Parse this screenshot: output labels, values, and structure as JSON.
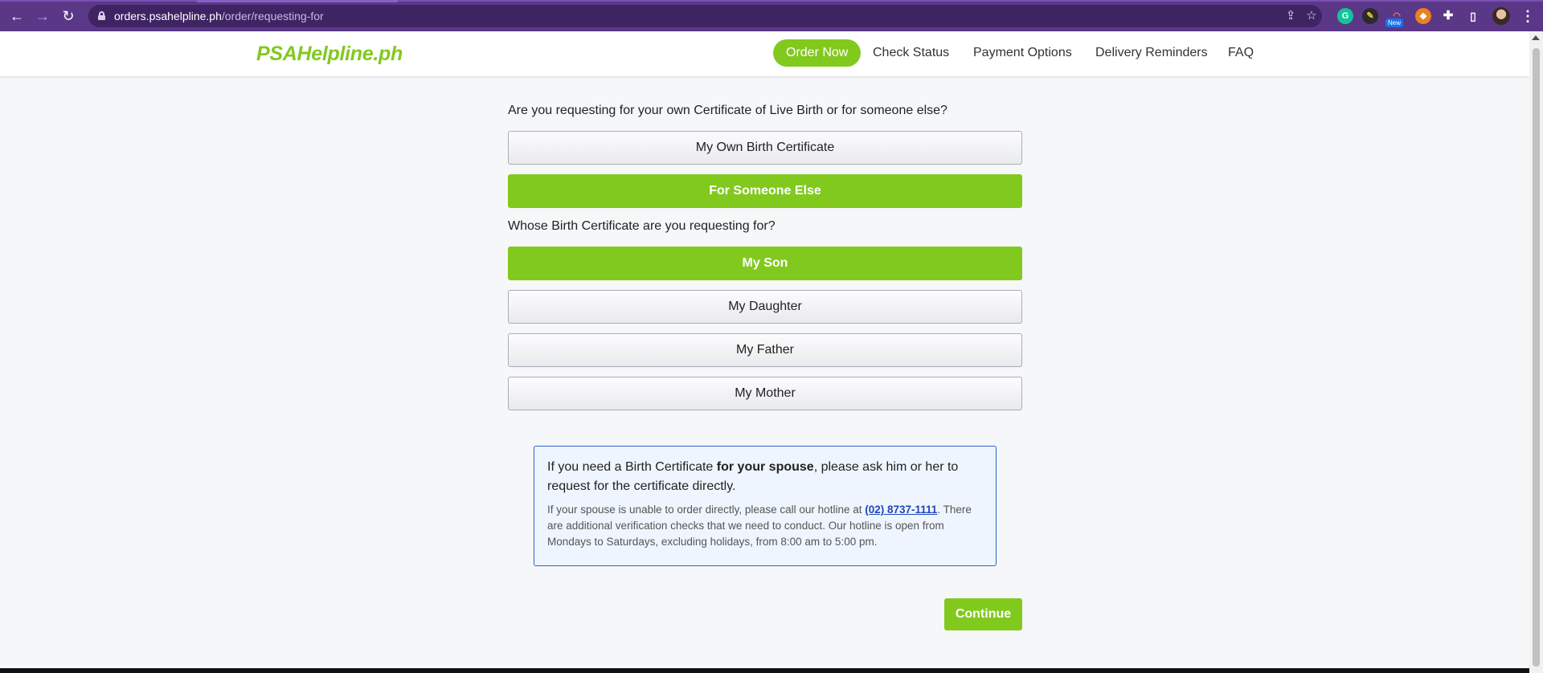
{
  "browser": {
    "url_host": "orders.psahelpline.ph",
    "url_path": "/order/requesting-for",
    "new_badge": "New",
    "icons": [
      "back-arrow-icon",
      "forward-arrow-icon",
      "reload-icon",
      "lock-icon",
      "share-icon",
      "bookmark-star-icon",
      "grammarly-icon",
      "extension-icon",
      "rainbow-extension-icon",
      "fox-extension-icon",
      "puzzle-icon",
      "side-panel-icon",
      "profile-avatar",
      "kebab-menu-icon"
    ]
  },
  "header": {
    "logo": "PSAHelpline.ph",
    "nav": [
      "Order Now",
      "Check Status",
      "Payment Options",
      "Delivery Reminders",
      "FAQ"
    ],
    "active_nav": "Order Now"
  },
  "form": {
    "question1": "Are you requesting for your own Certificate of Live Birth or for someone else?",
    "q1_options": [
      "My Own Birth Certificate",
      "For Someone Else"
    ],
    "q1_selected": "For Someone Else",
    "question2": "Whose Birth Certificate are you requesting for?",
    "q2_options": [
      "My Son",
      "My Daughter",
      "My Father",
      "My Mother"
    ],
    "q2_selected": "My Son"
  },
  "notice": {
    "main_prefix": "If you need a Birth Certificate ",
    "main_bold": "for your spouse",
    "main_suffix": ", please ask him or her to request for the certificate directly.",
    "sub_prefix": "If your spouse is unable to order directly, please call our hotline at ",
    "hotline": "(02) 8737-1111",
    "sub_suffix": ". There are additional verification checks that we need to conduct. Our hotline is open from Mondays to Saturdays, excluding holidays, from 8:00 am to 5:00 pm."
  },
  "actions": {
    "continue_label": "Continue"
  },
  "colors": {
    "brand_green": "#82c91e",
    "chrome_purple": "#5a3787",
    "notice_border": "#2f5fce"
  }
}
